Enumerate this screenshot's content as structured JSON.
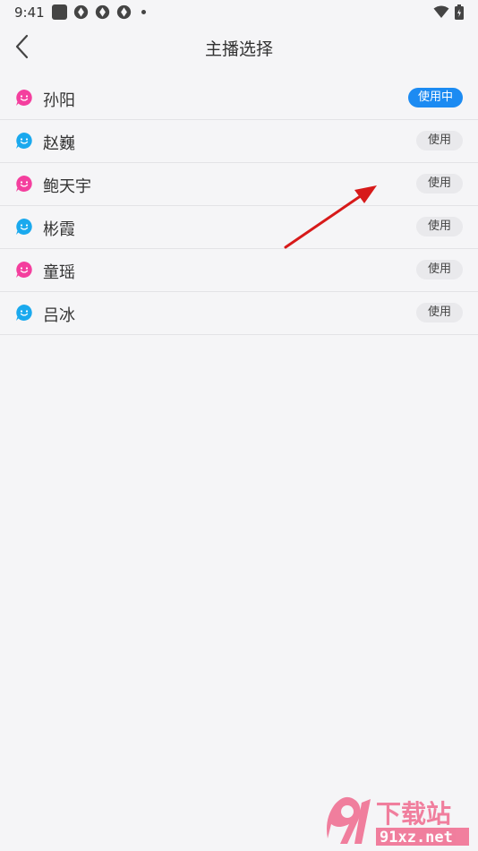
{
  "status": {
    "time": "9:41"
  },
  "header": {
    "title": "主播选择"
  },
  "anchors": [
    {
      "name": "孙阳",
      "button": "使用中",
      "active": true,
      "avatar_color": "#f43f9e"
    },
    {
      "name": "赵巍",
      "button": "使用",
      "active": false,
      "avatar_color": "#1aa9ee"
    },
    {
      "name": "鲍天宇",
      "button": "使用",
      "active": false,
      "avatar_color": "#f43f9e"
    },
    {
      "name": "彬霞",
      "button": "使用",
      "active": false,
      "avatar_color": "#1aa9ee"
    },
    {
      "name": "童瑶",
      "button": "使用",
      "active": false,
      "avatar_color": "#f43f9e"
    },
    {
      "name": "吕冰",
      "button": "使用",
      "active": false,
      "avatar_color": "#1aa9ee"
    }
  ],
  "watermark": {
    "brand": "下载站",
    "url": "91xz.net"
  },
  "colors": {
    "accent": "#1c8bf2",
    "annotation": "#d71a1a"
  }
}
